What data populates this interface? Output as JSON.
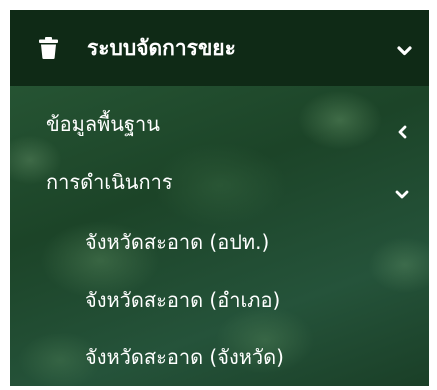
{
  "menu": {
    "header": {
      "title": "ระบบจัดการขยะ",
      "icon": "trash-icon",
      "toggle_icon": "chevron-down-icon"
    },
    "items": [
      {
        "label": "ข้อมูลพื้นฐาน",
        "icon": "chevron-left-icon",
        "expanded": false
      },
      {
        "label": "การดำเนินการ",
        "icon": "chevron-down-icon",
        "expanded": true
      }
    ],
    "submenu": [
      {
        "label": "จังหวัดสะอาด (อปท.)"
      },
      {
        "label": "จังหวัดสะอาด (อำเภอ)"
      },
      {
        "label": "จังหวัดสะอาด (จังหวัด)"
      }
    ]
  },
  "colors": {
    "header_bg": "#0f2a16",
    "menu_bg": "#1f4a2d",
    "text": "#ffffff"
  }
}
